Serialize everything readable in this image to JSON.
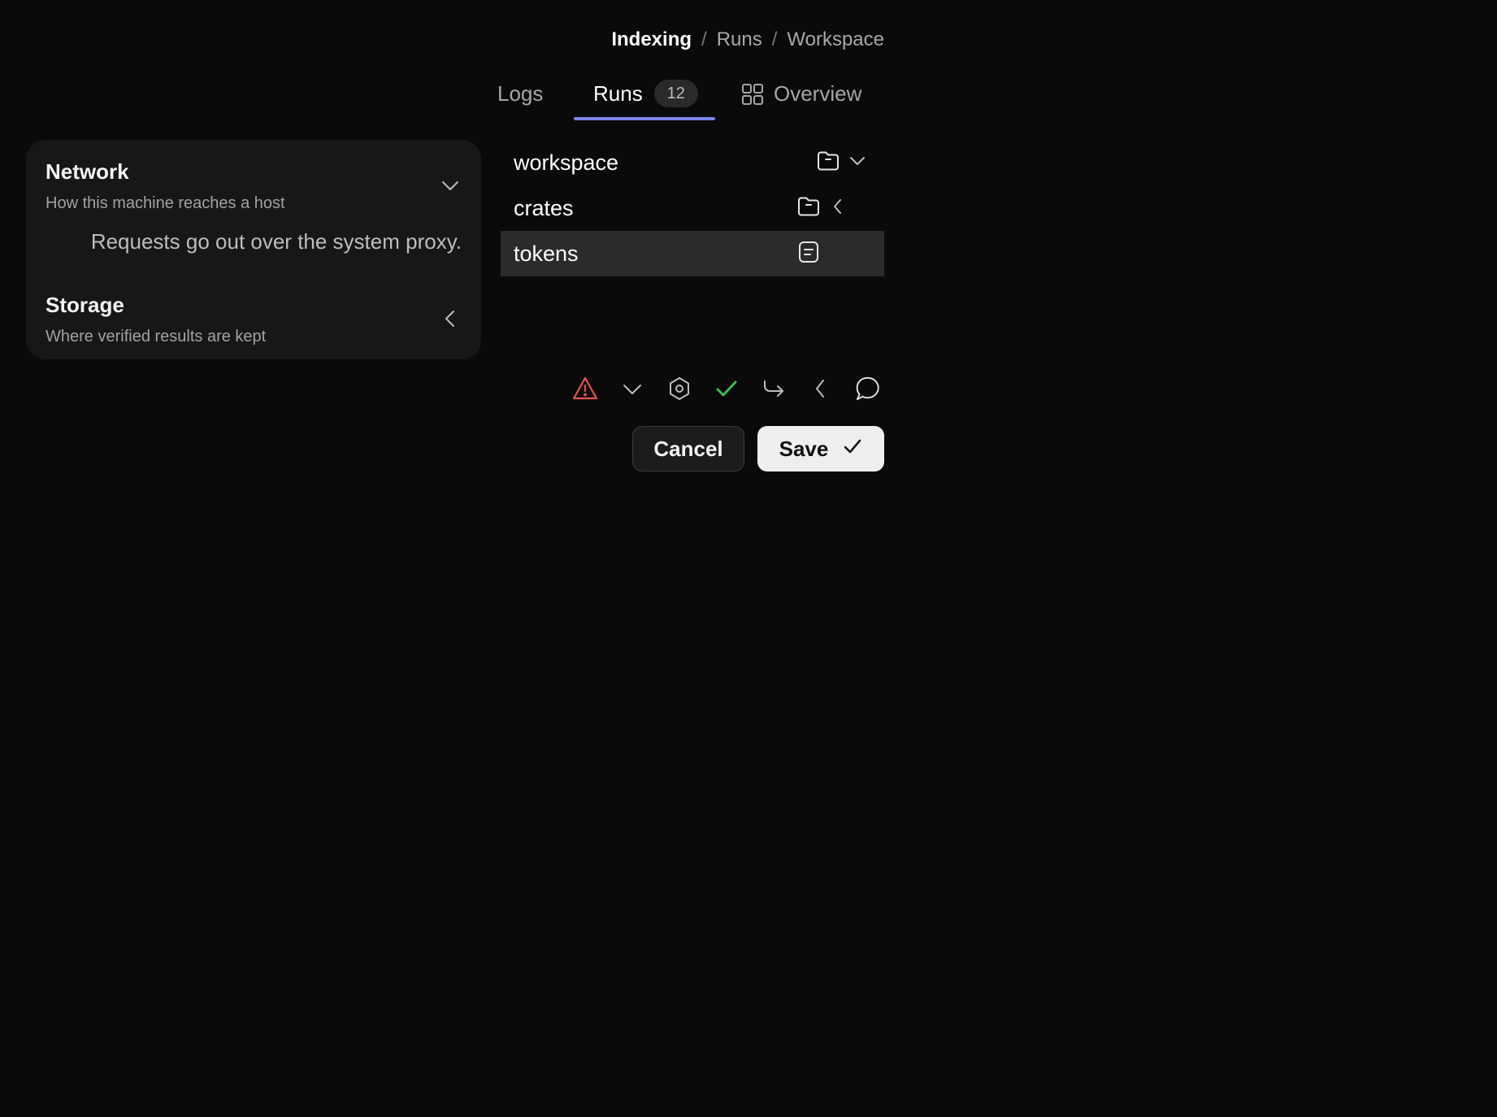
{
  "breadcrumb": {
    "items": [
      "Indexing",
      "Runs",
      "Workspace"
    ],
    "separator": "/"
  },
  "tabs": {
    "logs": "Logs",
    "runs": "Runs",
    "runs_count": "12",
    "overview": "Overview",
    "active": "Runs",
    "accent_color": "#7b83eb"
  },
  "settings": {
    "network": {
      "title": "Network",
      "subtitle": "How this machine reaches a host",
      "body": "Requests go out over the system proxy.",
      "state": "expanded"
    },
    "storage": {
      "title": "Storage",
      "subtitle": "Where verified results are kept",
      "state": "collapsed"
    }
  },
  "files": [
    {
      "name": "workspace",
      "icon": "folder-icon",
      "chevron": "chevron-down-icon"
    },
    {
      "name": "crates",
      "icon": "folder-icon",
      "chevron": "chevron-left-icon"
    },
    {
      "name": "tokens",
      "icon": "document-icon",
      "selected": true
    }
  ],
  "toolbar": {
    "icons": [
      "warning-icon",
      "chevron-down-icon",
      "settings-hex-icon",
      "check-icon",
      "redirect-arrow-icon",
      "chevron-left-icon",
      "chat-bubble-icon"
    ],
    "warning_color": "#e5534b",
    "check_color": "#3fb950"
  },
  "actions": {
    "cancel_label": "Cancel",
    "save_label": "Save"
  }
}
